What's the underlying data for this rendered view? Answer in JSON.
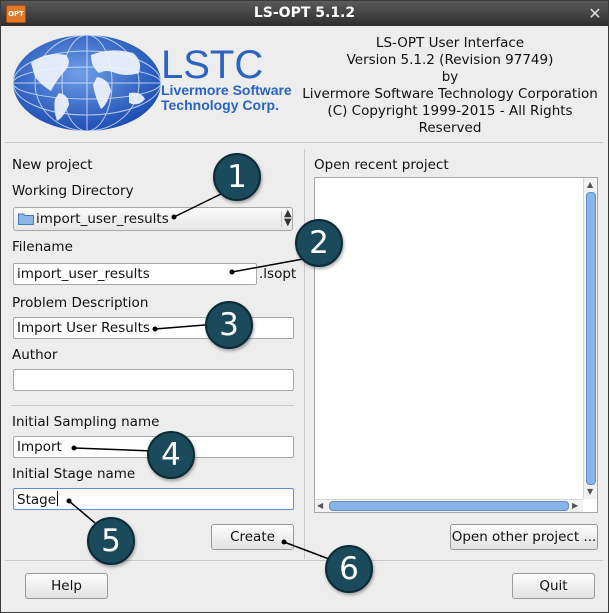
{
  "window": {
    "title": "LS-OPT 5.1.2",
    "icon": "app-icon",
    "icon_text": "OPT"
  },
  "about": {
    "line1": "LS-OPT User Interface",
    "line2": "Version 5.1.2 (Revision 97749)",
    "line3": "by",
    "line4": "Livermore Software Technology Corporation",
    "line5": "(C) Copyright 1999-2015 - All Rights Reserved"
  },
  "logo": {
    "brand": "LSTC",
    "line1": "Livermore Software",
    "line2": "Technology Corp.",
    "color": "#2b63c4"
  },
  "new_project": {
    "heading": "New project",
    "working_dir_label": "Working Directory",
    "working_dir_value": "import_user_results",
    "filename_label": "Filename",
    "filename_value": "import_user_results",
    "filename_suffix": ".lsopt",
    "problem_desc_label": "Problem Description",
    "problem_desc_value": "Import User Results",
    "author_label": "Author",
    "author_value": "",
    "sampling_label": "Initial Sampling name",
    "sampling_value": "Import",
    "stage_label": "Initial Stage name",
    "stage_value": "Stage",
    "create_button": "Create"
  },
  "recent": {
    "heading": "Open recent project",
    "items": [],
    "open_other_button": "Open other project ..."
  },
  "footer": {
    "help_button": "Help",
    "quit_button": "Quit"
  },
  "callouts": [
    "1",
    "2",
    "3",
    "4",
    "5",
    "6"
  ],
  "colors": {
    "callout_fill": "#1b4a5c",
    "accent": "#5b8fd6",
    "titlebar": "#3a3a3a"
  }
}
